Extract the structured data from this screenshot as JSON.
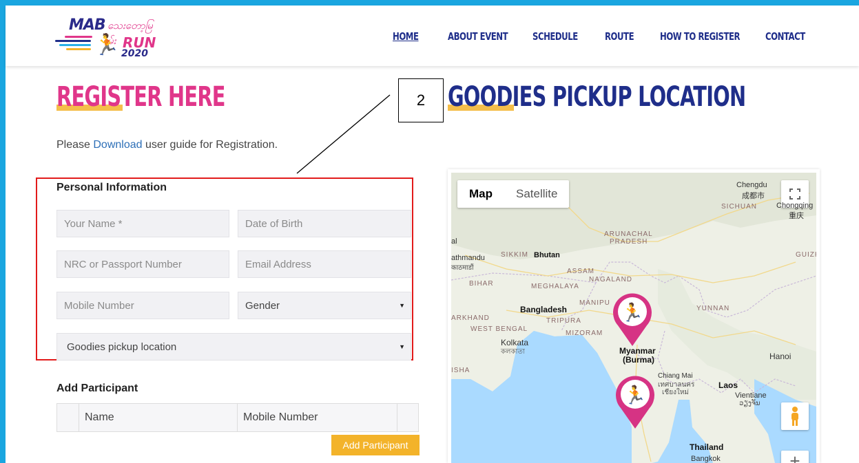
{
  "logo": {
    "brand": "MAB",
    "brand_mm": "သေးတော့မြမ်း",
    "run": "RUN",
    "year": "2020"
  },
  "nav": {
    "items": [
      {
        "label": "HOME",
        "active": true
      },
      {
        "label": "ABOUT EVENT",
        "active": false
      },
      {
        "label": "SCHEDULE",
        "active": false
      },
      {
        "label": "ROUTE",
        "active": false
      },
      {
        "label": "HOW TO REGISTER",
        "active": false
      },
      {
        "label": "CONTACT",
        "active": false
      }
    ]
  },
  "register": {
    "heading": "REGISTER HERE",
    "guide_prefix": "Please ",
    "guide_link": "Download",
    "guide_suffix": " user guide for Registration."
  },
  "callout": {
    "number": "2"
  },
  "personal": {
    "title": "Personal Information",
    "name_placeholder": "Your Name *",
    "dob_placeholder": "Date of Birth",
    "nrc_placeholder": "NRC or Passport Number",
    "email_placeholder": "Email Address",
    "mobile_placeholder": "Mobile Number",
    "gender_value": "Gender",
    "pickup_value": "Goodies pickup location"
  },
  "participant": {
    "title": "Add Participant",
    "columns": [
      "Name",
      "Mobile Number"
    ],
    "add_button": "Add Participant"
  },
  "goodies": {
    "heading": "GOODIES PICKUP LOCATION",
    "map_tabs": [
      {
        "label": "Map",
        "selected": true
      },
      {
        "label": "Satellite",
        "selected": false
      }
    ],
    "labels": {
      "chengdu": "Chengdu",
      "chengdu_zh": "成都市",
      "chongqing": "Chongqing",
      "chongqing_zh": "重庆",
      "sichuan": "SICHUAN",
      "arunachal": "ARUNACHAL",
      "pradesh": "PRADESH",
      "guizh": "GUIZH",
      "al": "al",
      "kathmandu": "athmandu",
      "kathmandu_ne": "काठमाडौं",
      "sikkim": "SIKKIM",
      "bhutan": "Bhutan",
      "assam": "ASSAM",
      "nagaland": "NAGALAND",
      "bihar": "BIHAR",
      "meghalaya": "MEGHALAYA",
      "manipur": "MANIPU",
      "yunnan": "YUNNAN",
      "bangladesh": "Bangladesh",
      "tripura": "TRIPURA",
      "jharkhand": "ARKHAND",
      "west_bengal": "WEST BENGAL",
      "mizoram": "MIZORAM",
      "kolkata": "Kolkata",
      "kolkata_bn": "কলকাতা",
      "myanmar": "Myanmar",
      "burma": "(Burma)",
      "hanoi": "Hanoi",
      "isha": "ISHA",
      "chiang_mai": "Chiang Mai",
      "chiang_mai_th1": "เทศบาลนคร",
      "chiang_mai_th2": "เชียงใหม่",
      "laos": "Laos",
      "vientiane": "Vientiane",
      "vientiane_lo": "ວຽງຈັນ",
      "thailand": "Thailand",
      "bangkok": "Bangkok"
    }
  },
  "colors": {
    "accent_pink": "#e0368a",
    "nav_blue": "#1f2e8a",
    "gold": "#f3b32a",
    "frame_blue": "#1aa6e0"
  }
}
